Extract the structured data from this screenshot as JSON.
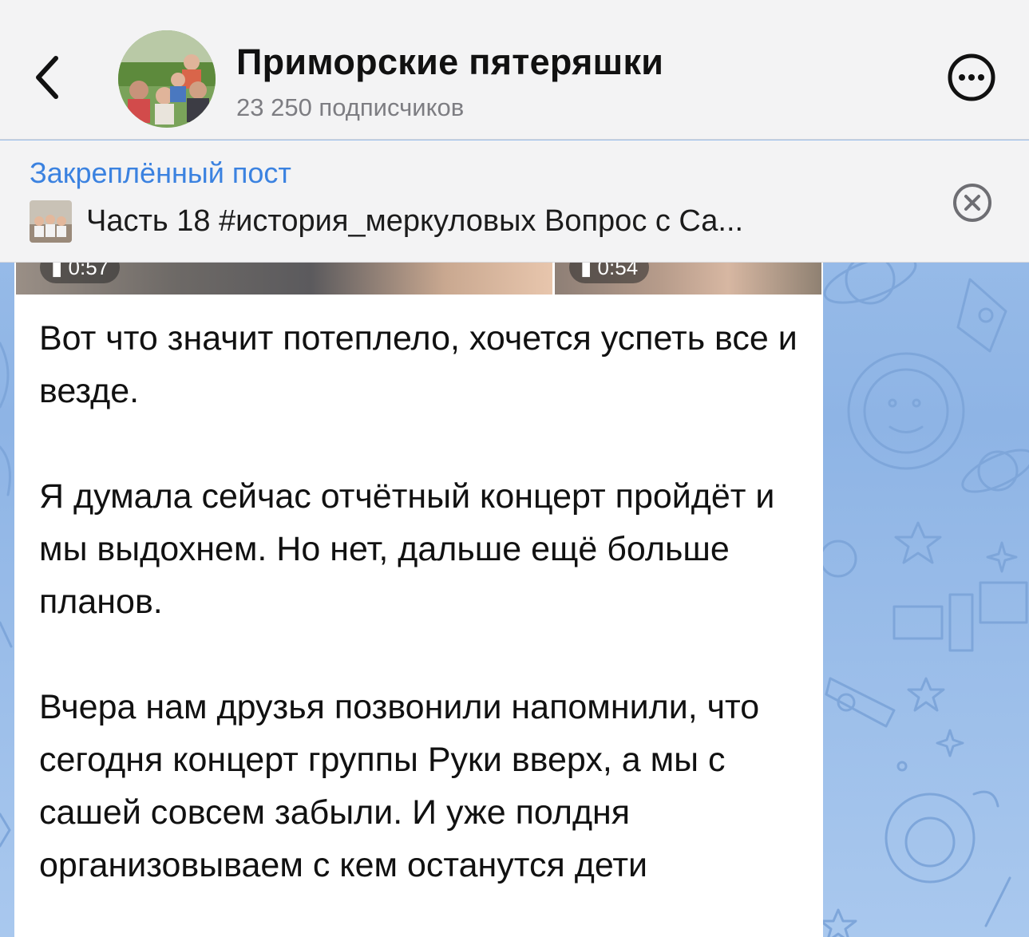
{
  "header": {
    "back_icon": "chevron-left-icon",
    "channel_title": "Приморские пятеряшки",
    "subscribers": "23 250 подписчиков",
    "more_icon": "ellipsis-circle-icon"
  },
  "pinned": {
    "label": "Закреплённый пост",
    "text": "Часть 18 #история_меркуловых Вопрос с Са...",
    "close_icon": "close-circle-icon"
  },
  "message": {
    "video_durations": [
      "0:57",
      "0:54"
    ],
    "paragraphs": [
      "Вот что значит потеплело, хочется успеть все и везде.",
      "Я думала сейчас отчётный концерт пройдёт и мы выдохнем. Но нет, дальше ещё больше планов.",
      "Вчера нам друзья позвонили напомнили,  что сегодня концерт группы Руки вверх, а мы с сашей совсем забыли. И уже полдня организовываем с кем останутся дети"
    ]
  },
  "colors": {
    "accent": "#3b82e0",
    "header_bg": "#f3f3f4",
    "wallpaper": "#8fb6e6"
  }
}
